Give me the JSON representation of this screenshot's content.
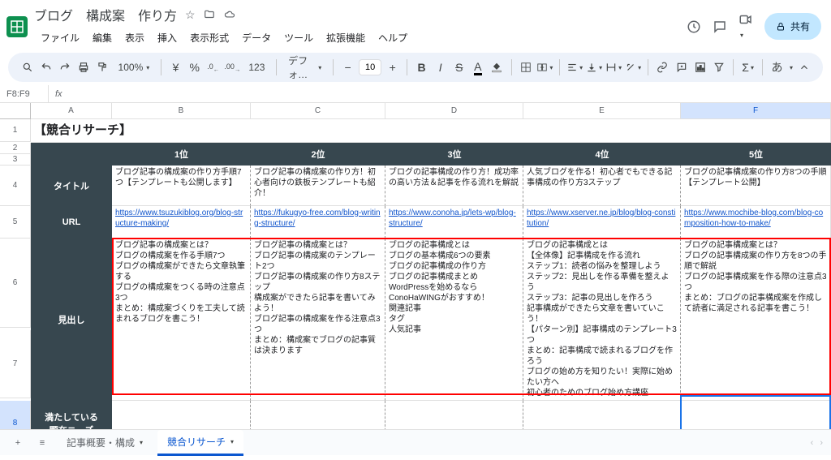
{
  "doc": {
    "title": "ブログ　構成案　作り方",
    "share": "共有"
  },
  "menus": [
    "ファイル",
    "編集",
    "表示",
    "挿入",
    "表示形式",
    "データ",
    "ツール",
    "拡張機能",
    "ヘルプ"
  ],
  "toolbar": {
    "zoom": "100%",
    "currency": "¥",
    "percent": "%",
    "dec_dec": ".0",
    "dec_inc": ".00",
    "num_fmt": "123",
    "font": "デフォ…",
    "font_size": "10",
    "ime": "あ"
  },
  "name_box": "F8:F9",
  "columns": [
    "",
    "A",
    "B",
    "C",
    "D",
    "E",
    "F"
  ],
  "rows": [
    "1",
    "2",
    "3",
    "4",
    "5",
    "6",
    "7",
    "8"
  ],
  "section_title": "【競合リサーチ】",
  "rank_headers": [
    "1位",
    "2位",
    "3位",
    "4位",
    "5位"
  ],
  "side_labels": {
    "title": "タイトル",
    "url": "URL",
    "heading": "見出し",
    "needs": "満たしている\n顕在ニーズ"
  },
  "titles": [
    "ブログ記事の構成案の作り方手順7つ【テンプレートも公開します】",
    "ブログ記事の構成案の作り方！初心者向けの鉄板テンプレートも紹介！",
    "ブログの記事構成の作り方！成功率の高い方法＆記事を作る流れを解説",
    "人気ブログを作る！初心者でもできる記事構成の作り方3ステップ",
    "ブログの記事構成案の作り方8つの手順【テンプレート公開】"
  ],
  "urls": [
    "https://www.tsuzukiblog.org/blog-structure-making/",
    "https://fukugyo-free.com/blog-writing-structure/",
    "https://www.conoha.jp/lets-wp/blog-structure/",
    "https://www.xserver.ne.jp/blog/blog-constitution/",
    "https://www.mochibe-blog.com/blog-composition-how-to-make/"
  ],
  "headings": [
    "ブログ記事の構成案とは？\nブログの構成案を作る手順7つ\nブログの構成案ができたら文章執筆する\nブログの構成案をつくる時の注意点3つ\nまとめ：構成案づくりを工夫して読まれるブログを書こう！",
    "ブログ記事の構成案とは？\nブログ記事の構成案のテンプレート2つ\nブログ記事の構成案の作り方8ステップ\n構成案ができたら記事を書いてみよう！\nブログ記事の構成案を作る注意点3つ\nまとめ：構成案でブログの記事質は決まります",
    "ブログの記事構成とは\nブログの基本構成6つの要素\nブログの記事構成の作り方\nブログの記事構成まとめ\nWordPressを始めるならConoHaWINGがおすすめ！\n関連記事\nタグ\n人気記事",
    "ブログの記事構成とは\n【全体像】記事構成を作る流れ\nステップ1：読者の悩みを整理しよう\nステップ2：見出しを作る準備を整えよう\nステップ3：記事の見出しを作ろう\n記事構成ができたら文章を書いていこう！\n【パターン別】記事構成のテンプレート3つ\nまとめ：記事構成で読まれるブログを作ろう\nブログの始め方を知りたい！実際に始めたい方へ\n初心者のためのブログ始め方講座",
    "ブログの記事構成案とは？\nブログの記事構成案の作り方を8つの手順で解説\nブログの記事構成案を作る際の注意点3つ\nまとめ：ブログの記事構成案を作成して読者に満足される記事を書こう！"
  ],
  "sheets": {
    "tab1": "記事概要・構成",
    "tab2": "競合リサーチ"
  }
}
